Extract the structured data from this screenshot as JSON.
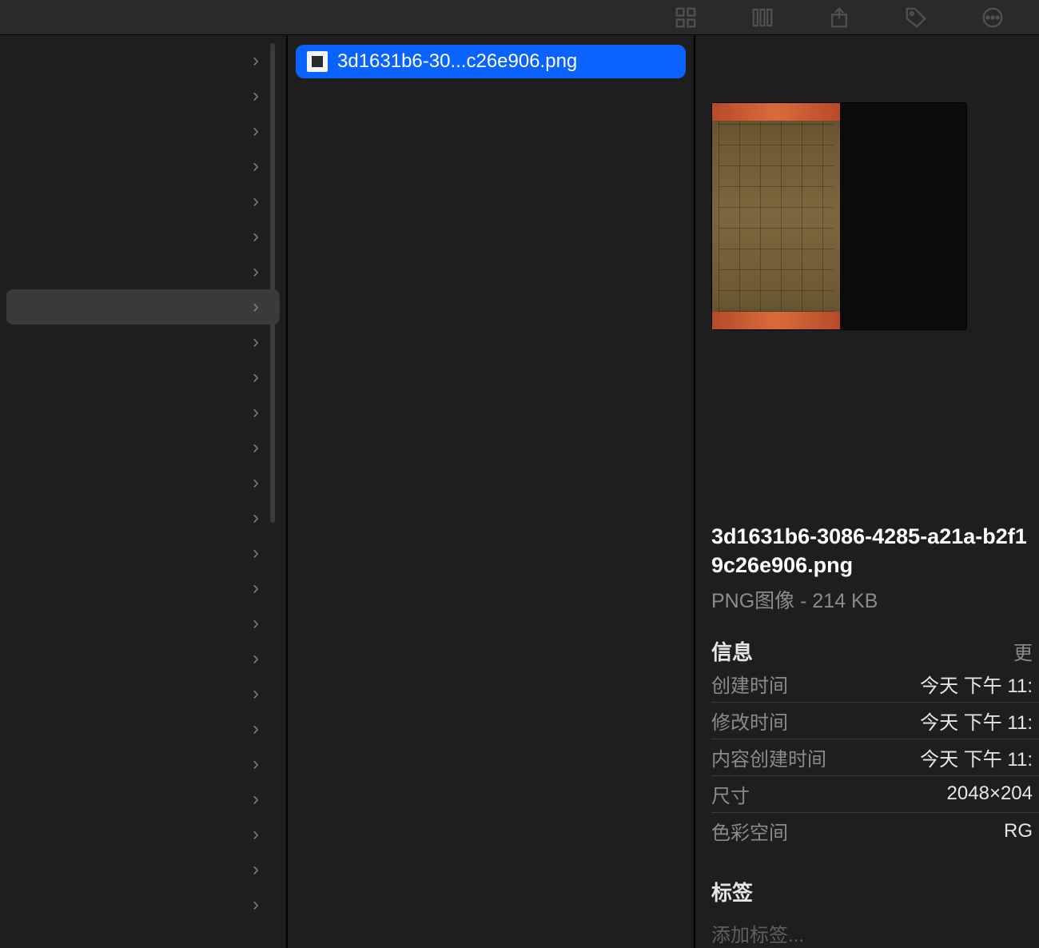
{
  "folders": {
    "rows": 25,
    "selected_index": 7
  },
  "files": {
    "selected": {
      "display_name": "3d1631b6-30...c26e906.png"
    }
  },
  "preview": {
    "filename": "3d1631b6-3086-4285-a21a-b2f19c26e906.png",
    "type_line": "PNG图像 - 214 KB",
    "info": {
      "heading": "信息",
      "more_label": "更",
      "rows": [
        {
          "k": "创建时间",
          "v": "今天 下午 11:"
        },
        {
          "k": "修改时间",
          "v": "今天 下午 11:"
        },
        {
          "k": "内容创建时间",
          "v": "今天 下午 11:"
        },
        {
          "k": "尺寸",
          "v": "2048×204"
        },
        {
          "k": "色彩空间",
          "v": "RG"
        }
      ]
    },
    "tags": {
      "heading": "标签",
      "placeholder": "添加标签..."
    }
  }
}
